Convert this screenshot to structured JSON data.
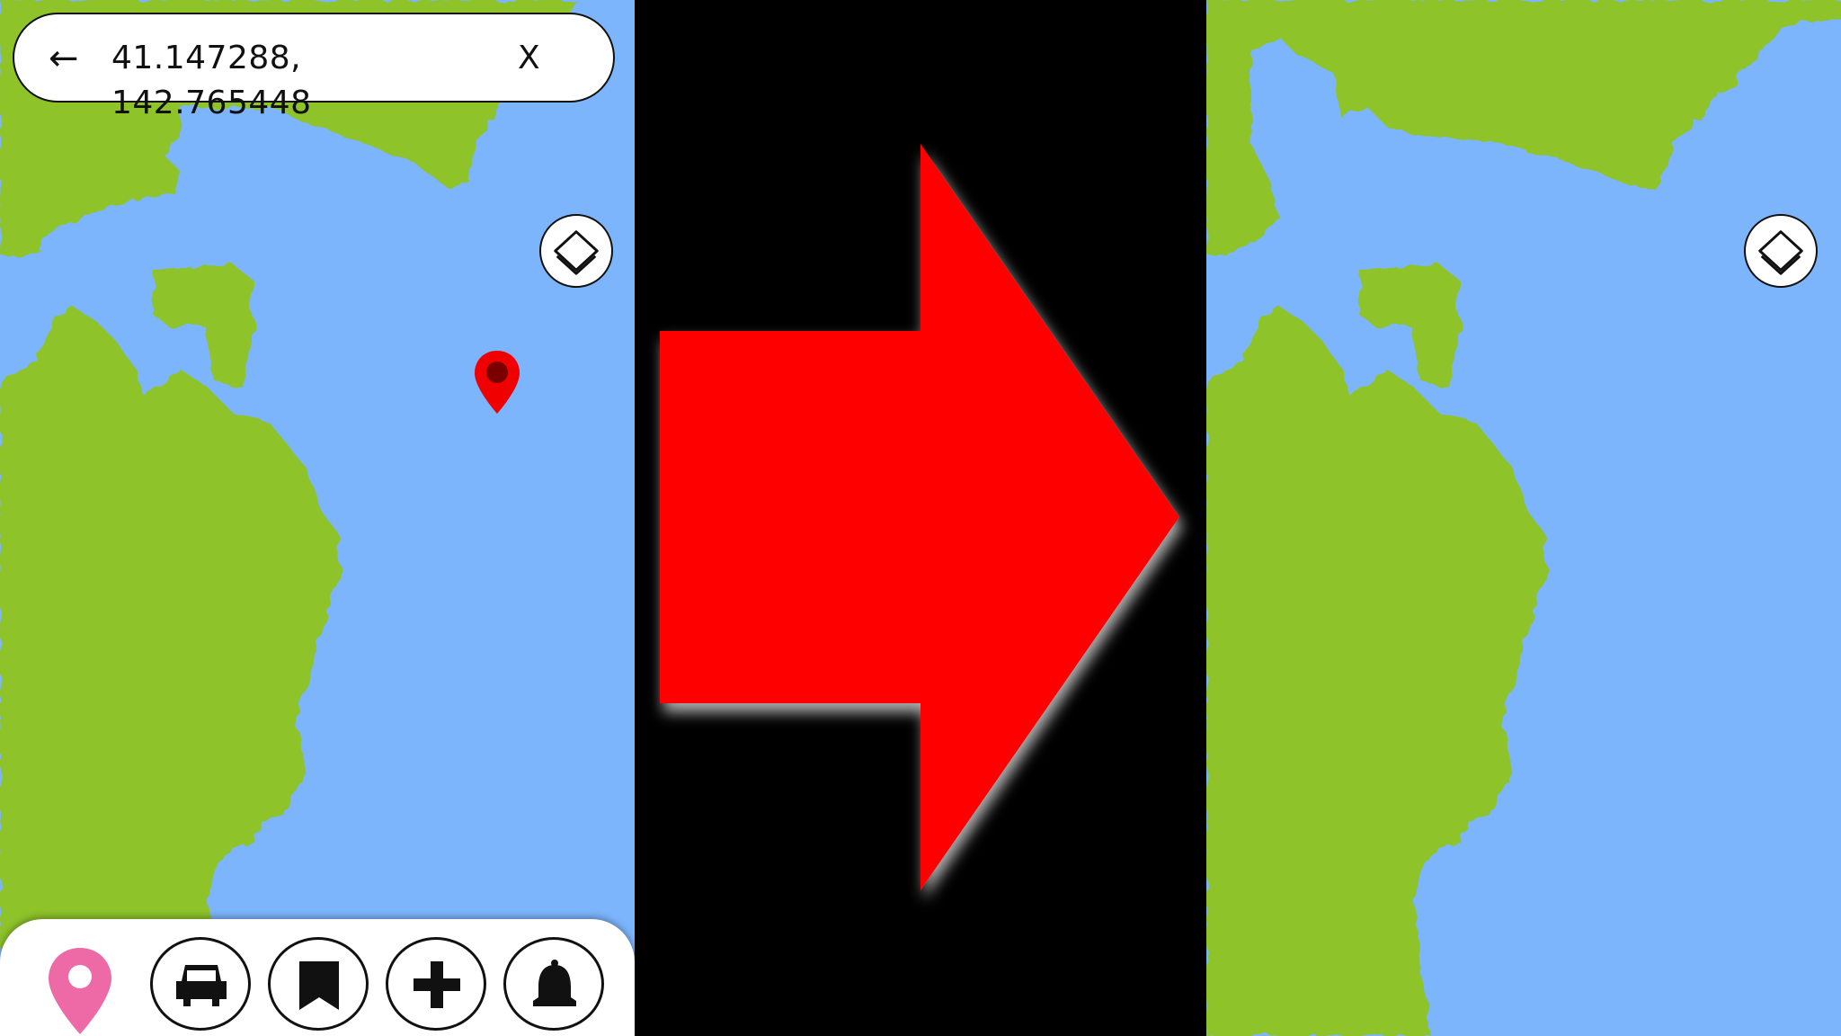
{
  "search": {
    "back_symbol": "←",
    "value": "41.147288, 142.765448",
    "clear_symbol": "X"
  },
  "icons": {
    "back": "back-arrow-icon",
    "clear": "close-icon",
    "layers": "layers-icon",
    "marker": "map-marker-icon",
    "pin": "location-pin-icon",
    "car": "car-icon",
    "bookmark": "bookmark-icon",
    "add": "plus-icon",
    "bell": "bell-icon",
    "transition": "right-arrow-icon"
  },
  "colors": {
    "water": "#7cb5fb",
    "land": "#8ec32b",
    "marker": "#f00000",
    "pin": "#ee6aa7",
    "arrow": "#ff0000",
    "background": "#000000"
  }
}
